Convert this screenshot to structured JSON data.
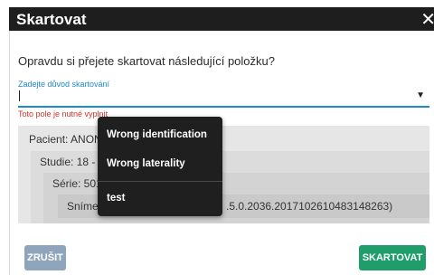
{
  "dialog": {
    "title": "Skartovat",
    "close_symbol": "✕",
    "question": "Opravdu si přejete skartovat následující položku?"
  },
  "reason_field": {
    "label": "Zadejte důvod skartování",
    "value": "",
    "error": "Toto pole je nutné vyplnit"
  },
  "tree": {
    "patient": "Pacient: ANON",
    "study": "Studie: 18 - N",
    "series": "Série: 501",
    "image": "Snímek:",
    "image_tail": ".5.0.2036.20171026104831482​63)"
  },
  "menu": {
    "items": [
      "Wrong identification",
      "Wrong laterality",
      "test"
    ]
  },
  "buttons": {
    "cancel": "ZRUŠIT",
    "confirm": "SKARTOVAT"
  },
  "colors": {
    "accent": "#1a8ccf",
    "error": "#d93025",
    "confirm": "#1f9d6b",
    "cancel": "#8fa5bb"
  }
}
